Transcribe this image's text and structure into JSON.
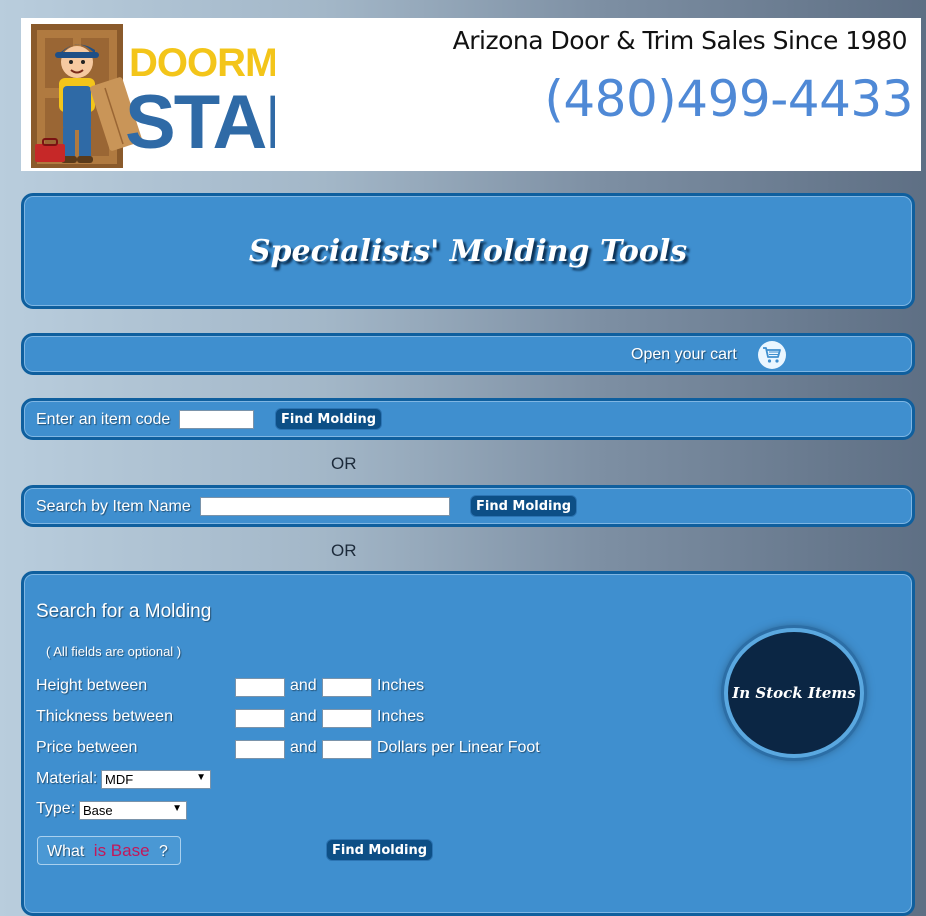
{
  "header": {
    "logo_word_top": "DOORMAN",
    "logo_word_bottom": "STAN",
    "tagline": "Arizona Door & Trim Sales Since 1980",
    "phone": "(480)499-4433"
  },
  "title": "Specialists' Molding Tools",
  "cart": {
    "label": "Open your cart",
    "icon": "shopping-cart-icon"
  },
  "item_code_search": {
    "label": "Enter an item code",
    "value": "",
    "button": "Find Molding"
  },
  "or_label": "OR",
  "name_search": {
    "label": "Search by Item Name",
    "value": "",
    "button": "Find Molding"
  },
  "molding_search": {
    "heading": "Search for a Molding",
    "note": "( All fields are optional )",
    "and_label": "and",
    "height": {
      "label": "Height between",
      "min": "",
      "max": "",
      "unit": "Inches"
    },
    "thickness": {
      "label": "Thickness between",
      "min": "",
      "max": "",
      "unit": "Inches"
    },
    "price": {
      "label": "Price between",
      "min": "",
      "max": "",
      "unit": "Dollars per Linear Foot"
    },
    "material": {
      "label": "Material:",
      "selected": "MDF"
    },
    "type": {
      "label": "Type:",
      "selected": "Base"
    },
    "what_is": {
      "prefix": "What",
      "term": "is Base",
      "suffix": "?"
    },
    "button": "Find Molding",
    "in_stock_button": "In Stock Items"
  },
  "colors": {
    "panel": "#3f8fcf",
    "panel_border": "#0f5f9e",
    "button": "#0d4f86",
    "phone": "#4f89d6",
    "logo_yellow": "#f3c51a",
    "logo_blue": "#2f6aa6",
    "highlight_pink": "#c2185b"
  }
}
